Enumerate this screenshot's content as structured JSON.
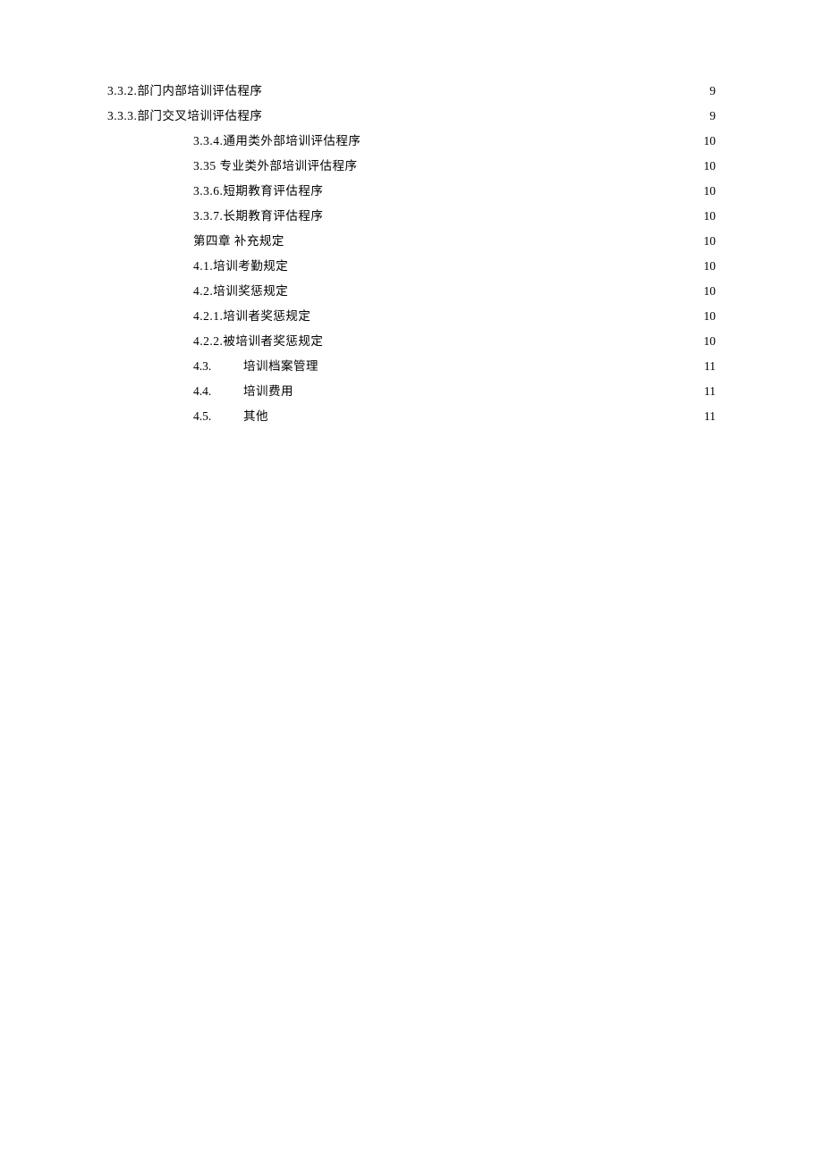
{
  "toc": [
    {
      "indent": 0,
      "num": "3.3.2.",
      "gap": false,
      "title": "部门内部培训评估程序",
      "page": "9"
    },
    {
      "indent": 0,
      "num": "3.3.3.",
      "gap": false,
      "title": "部门交叉培训评估程序",
      "page": "9"
    },
    {
      "indent": 1,
      "num": "3.3.4.",
      "gap": false,
      "title": "通用类外部培训评估程序",
      "page": "10"
    },
    {
      "indent": 1,
      "num": "3.35",
      "gap": false,
      "title": " 专业类外部培训评估程序",
      "page": "10"
    },
    {
      "indent": 1,
      "num": "3.3.6.",
      "gap": false,
      "title": "短期教育评估程序",
      "page": "10"
    },
    {
      "indent": 1,
      "num": "3.3.7.",
      "gap": false,
      "title": "长期教育评估程序",
      "page": "10"
    },
    {
      "indent": 1,
      "num": "",
      "gap": false,
      "title": "第四章 补充规定",
      "page": "10"
    },
    {
      "indent": 1,
      "num": "4.1.",
      "gap": false,
      "title": "培训考勤规定",
      "page": "10"
    },
    {
      "indent": 1,
      "num": "4.2.",
      "gap": false,
      "title": "培训奖惩规定",
      "page": "10"
    },
    {
      "indent": 1,
      "num": "4.2.1.",
      "gap": false,
      "title": "培训者奖惩规定",
      "page": "10"
    },
    {
      "indent": 1,
      "num": "4.2.2.",
      "gap": false,
      "title": "被培训者奖惩规定",
      "page": "10"
    },
    {
      "indent": 1,
      "num": "4.3.",
      "gap": true,
      "title": "培训档案管理",
      "page": "11"
    },
    {
      "indent": 1,
      "num": "4.4.",
      "gap": true,
      "title": "培训费用",
      "page": "11"
    },
    {
      "indent": 1,
      "num": "4.5.",
      "gap": true,
      "title": "其他",
      "page": "11"
    }
  ]
}
